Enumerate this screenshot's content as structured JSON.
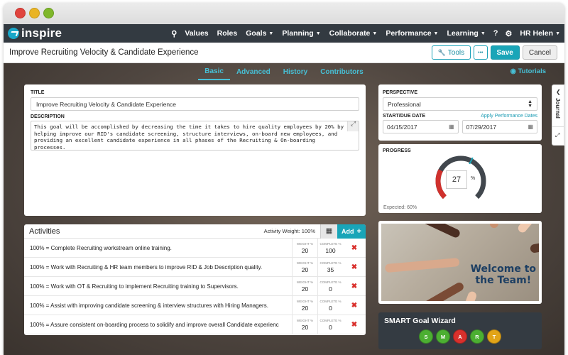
{
  "app": {
    "brand": "inspire"
  },
  "nav": {
    "items": [
      "Values",
      "Roles",
      "Goals",
      "Planning",
      "Collaborate",
      "Performance",
      "Learning"
    ],
    "dropdown": [
      false,
      false,
      true,
      true,
      true,
      true,
      true
    ],
    "help_icon": "?",
    "user": "HR Helen"
  },
  "page": {
    "title": "Improve Recruiting Velocity & Candidate Experience",
    "tools_label": "Tools",
    "more_label": "•••",
    "save_label": "Save",
    "cancel_label": "Cancel"
  },
  "tabs": [
    "Basic",
    "Advanced",
    "History",
    "Contributors"
  ],
  "active_tab": "Basic",
  "tutorials": "Tutorials",
  "form": {
    "title_label": "TITLE",
    "title_value": "Improve Recruiting Velocity & Candidate Experience",
    "description_label": "DESCRIPTION",
    "description_value": "This goal will be accomplished by decreasing the time it takes to hire quality employees by 20% by helping improve our RID's candidate screening, structure interviews, on-board new employees, and providing an excellent candidate experience in all phases of the Recruiting & On-boarding processes."
  },
  "perspective": {
    "label": "PERSPECTIVE",
    "value": "Professional",
    "dates_label": "START/DUE DATE",
    "apply_link": "Apply Performance Dates",
    "start": "04/15/2017",
    "due": "07/29/2017"
  },
  "progress": {
    "label": "PROGRESS",
    "value": "27",
    "unit": "%",
    "fraction": 0.27,
    "expected_fraction": 0.6,
    "expected_text": "Expected: 60%",
    "colors": {
      "done": "#d0312d",
      "remaining": "#41474d",
      "marker": "#19a5b8"
    }
  },
  "journal": {
    "label": "Journal"
  },
  "activities": {
    "title": "Activities",
    "weight_text": "Activity Weight: 100%",
    "add_label": "Add",
    "weight_header": "WEIGHT %",
    "complete_header": "COMPLETE %",
    "rows": [
      {
        "text": "100% = Complete Recruiting workstream online training.",
        "weight": "20",
        "complete": "100"
      },
      {
        "text": "100% = Work with Recruiting & HR team members to improve RID & Job Description quality.",
        "weight": "20",
        "complete": "35"
      },
      {
        "text": "100% = Work with OT & Recruiting to implement Recruiting training to Supervisors.",
        "weight": "20",
        "complete": "0"
      },
      {
        "text": "100% = Assist with improving candidate screening & interview structures with Hiring Managers.",
        "weight": "20",
        "complete": "0"
      },
      {
        "text": "100% = Assure consistent on-boarding process to solidify and improve overall Candidate experienc",
        "weight": "20",
        "complete": "0"
      }
    ]
  },
  "welcome": {
    "line1": "Welcome to",
    "line2": "the Team!"
  },
  "smart": {
    "title": "SMART Goal Wizard",
    "letters": [
      {
        "letter": "S",
        "color": "#4caf32"
      },
      {
        "letter": "M",
        "color": "#4caf32"
      },
      {
        "letter": "A",
        "color": "#d9302c"
      },
      {
        "letter": "R",
        "color": "#4caf32"
      },
      {
        "letter": "T",
        "color": "#e2a418"
      }
    ]
  }
}
